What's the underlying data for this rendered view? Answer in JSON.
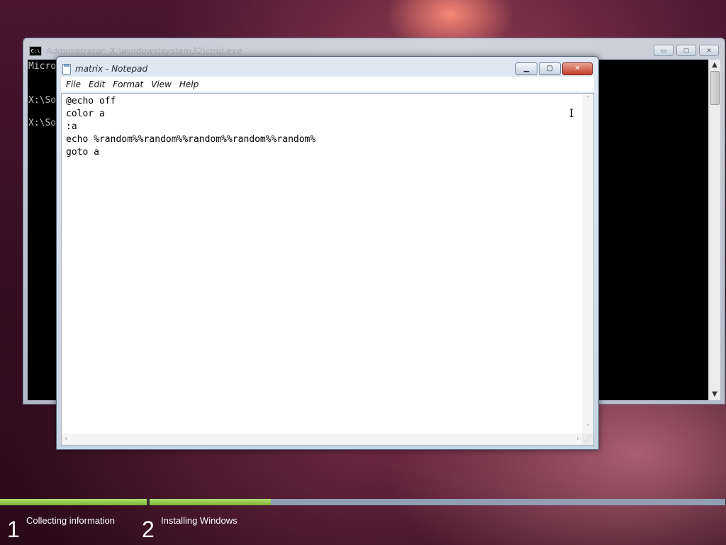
{
  "cmd": {
    "title": "Administrator: X:\\windows\\system32\\cmd.exe",
    "icon_label": "C:\\",
    "lines": [
      "Micro",
      "X:\\So",
      "X:\\So"
    ],
    "buttons": {
      "minimize": "▭",
      "maximize": "▢",
      "close": "✕"
    }
  },
  "notepad": {
    "title": "matrix - Notepad",
    "menu": [
      "File",
      "Edit",
      "Format",
      "View",
      "Help"
    ],
    "content": "@echo off\ncolor a\n:a\necho %random%%random%%random%%random%%random%\ngoto a",
    "buttons": {
      "minimize": "▁",
      "maximize": "▢",
      "close": "✕"
    }
  },
  "setup": {
    "steps": [
      {
        "number": "1",
        "label": "Collecting information"
      },
      {
        "number": "2",
        "label": "Installing Windows"
      }
    ],
    "progress": {
      "step1_complete": 1.0,
      "step2_complete": 0.21
    }
  },
  "colors": {
    "progress_fill": "#8cc43c",
    "progress_track": "#8f9fb4",
    "close_button": "#c2402d"
  }
}
